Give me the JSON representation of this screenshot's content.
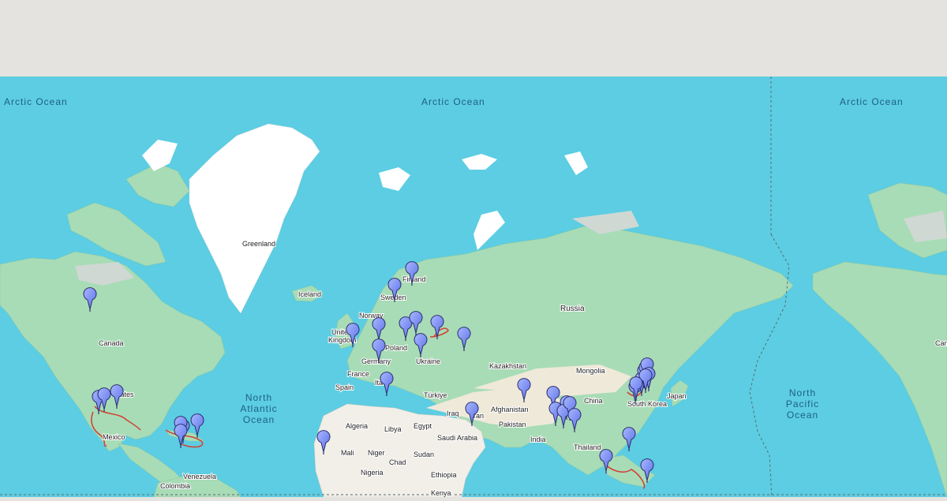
{
  "map": {
    "oceans": [
      {
        "id": "arctic-1",
        "text": "Arctic Ocean"
      },
      {
        "id": "arctic-2",
        "text": "Arctic Ocean"
      },
      {
        "id": "arctic-3",
        "text": "Arctic Ocean"
      },
      {
        "id": "north-atlantic",
        "lines": [
          "North",
          "Atlantic",
          "Ocean"
        ]
      },
      {
        "id": "north-pacific",
        "lines": [
          "North",
          "Pacific",
          "Ocean"
        ]
      }
    ],
    "places": {
      "greenland": "Greenland",
      "iceland": "Iceland",
      "canada": "Canada",
      "states": "tates",
      "mexico": "Mexico",
      "venezuela": "Venezuela",
      "colombia": "Colombia",
      "norway": "Norway",
      "sweden": "Sweden",
      "finland": "Finland",
      "uk1": "United",
      "uk2": "Kingdom",
      "poland": "Poland",
      "germany": "Germany",
      "france": "France",
      "spain": "Spain",
      "italy": "Ita",
      "ukraine": "Ukraine",
      "turkiye": "Türkiye",
      "russia": "Russia",
      "kazakhstan": "Kazakhstan",
      "mongolia": "Mongolia",
      "china": "China",
      "japan": "Japan",
      "south_korea": "South Korea",
      "afghanistan": "Afghanistan",
      "pakistan": "Pakistan",
      "iran": "ran",
      "iraq": "Iraq",
      "india": "India",
      "thailand": "Thailand",
      "algeria": "Algeria",
      "libya": "Libya",
      "egypt": "Egypt",
      "saudi": "Saudi Arabia",
      "mali": "Mali",
      "niger": "Niger",
      "chad": "Chad",
      "sudan": "Sudan",
      "nigeria": "Nigeria",
      "ethiopia": "Ethiopia",
      "kenya": "Kenya",
      "can2": "Can"
    },
    "marker_count": 46
  }
}
